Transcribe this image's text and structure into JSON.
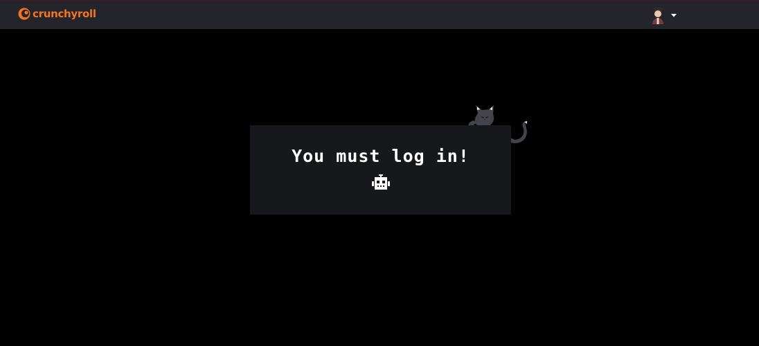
{
  "header": {
    "brand": "crunchyroll",
    "brand_color": "#f47521",
    "logo_icon": "crunchyroll-logo-icon",
    "account_icon": "user-avatar-icon",
    "menu_icon": "caret-down-icon"
  },
  "main": {
    "message": "You must log in!",
    "icon": "robot-icon",
    "decoration": "cat-mascot-illustration"
  }
}
